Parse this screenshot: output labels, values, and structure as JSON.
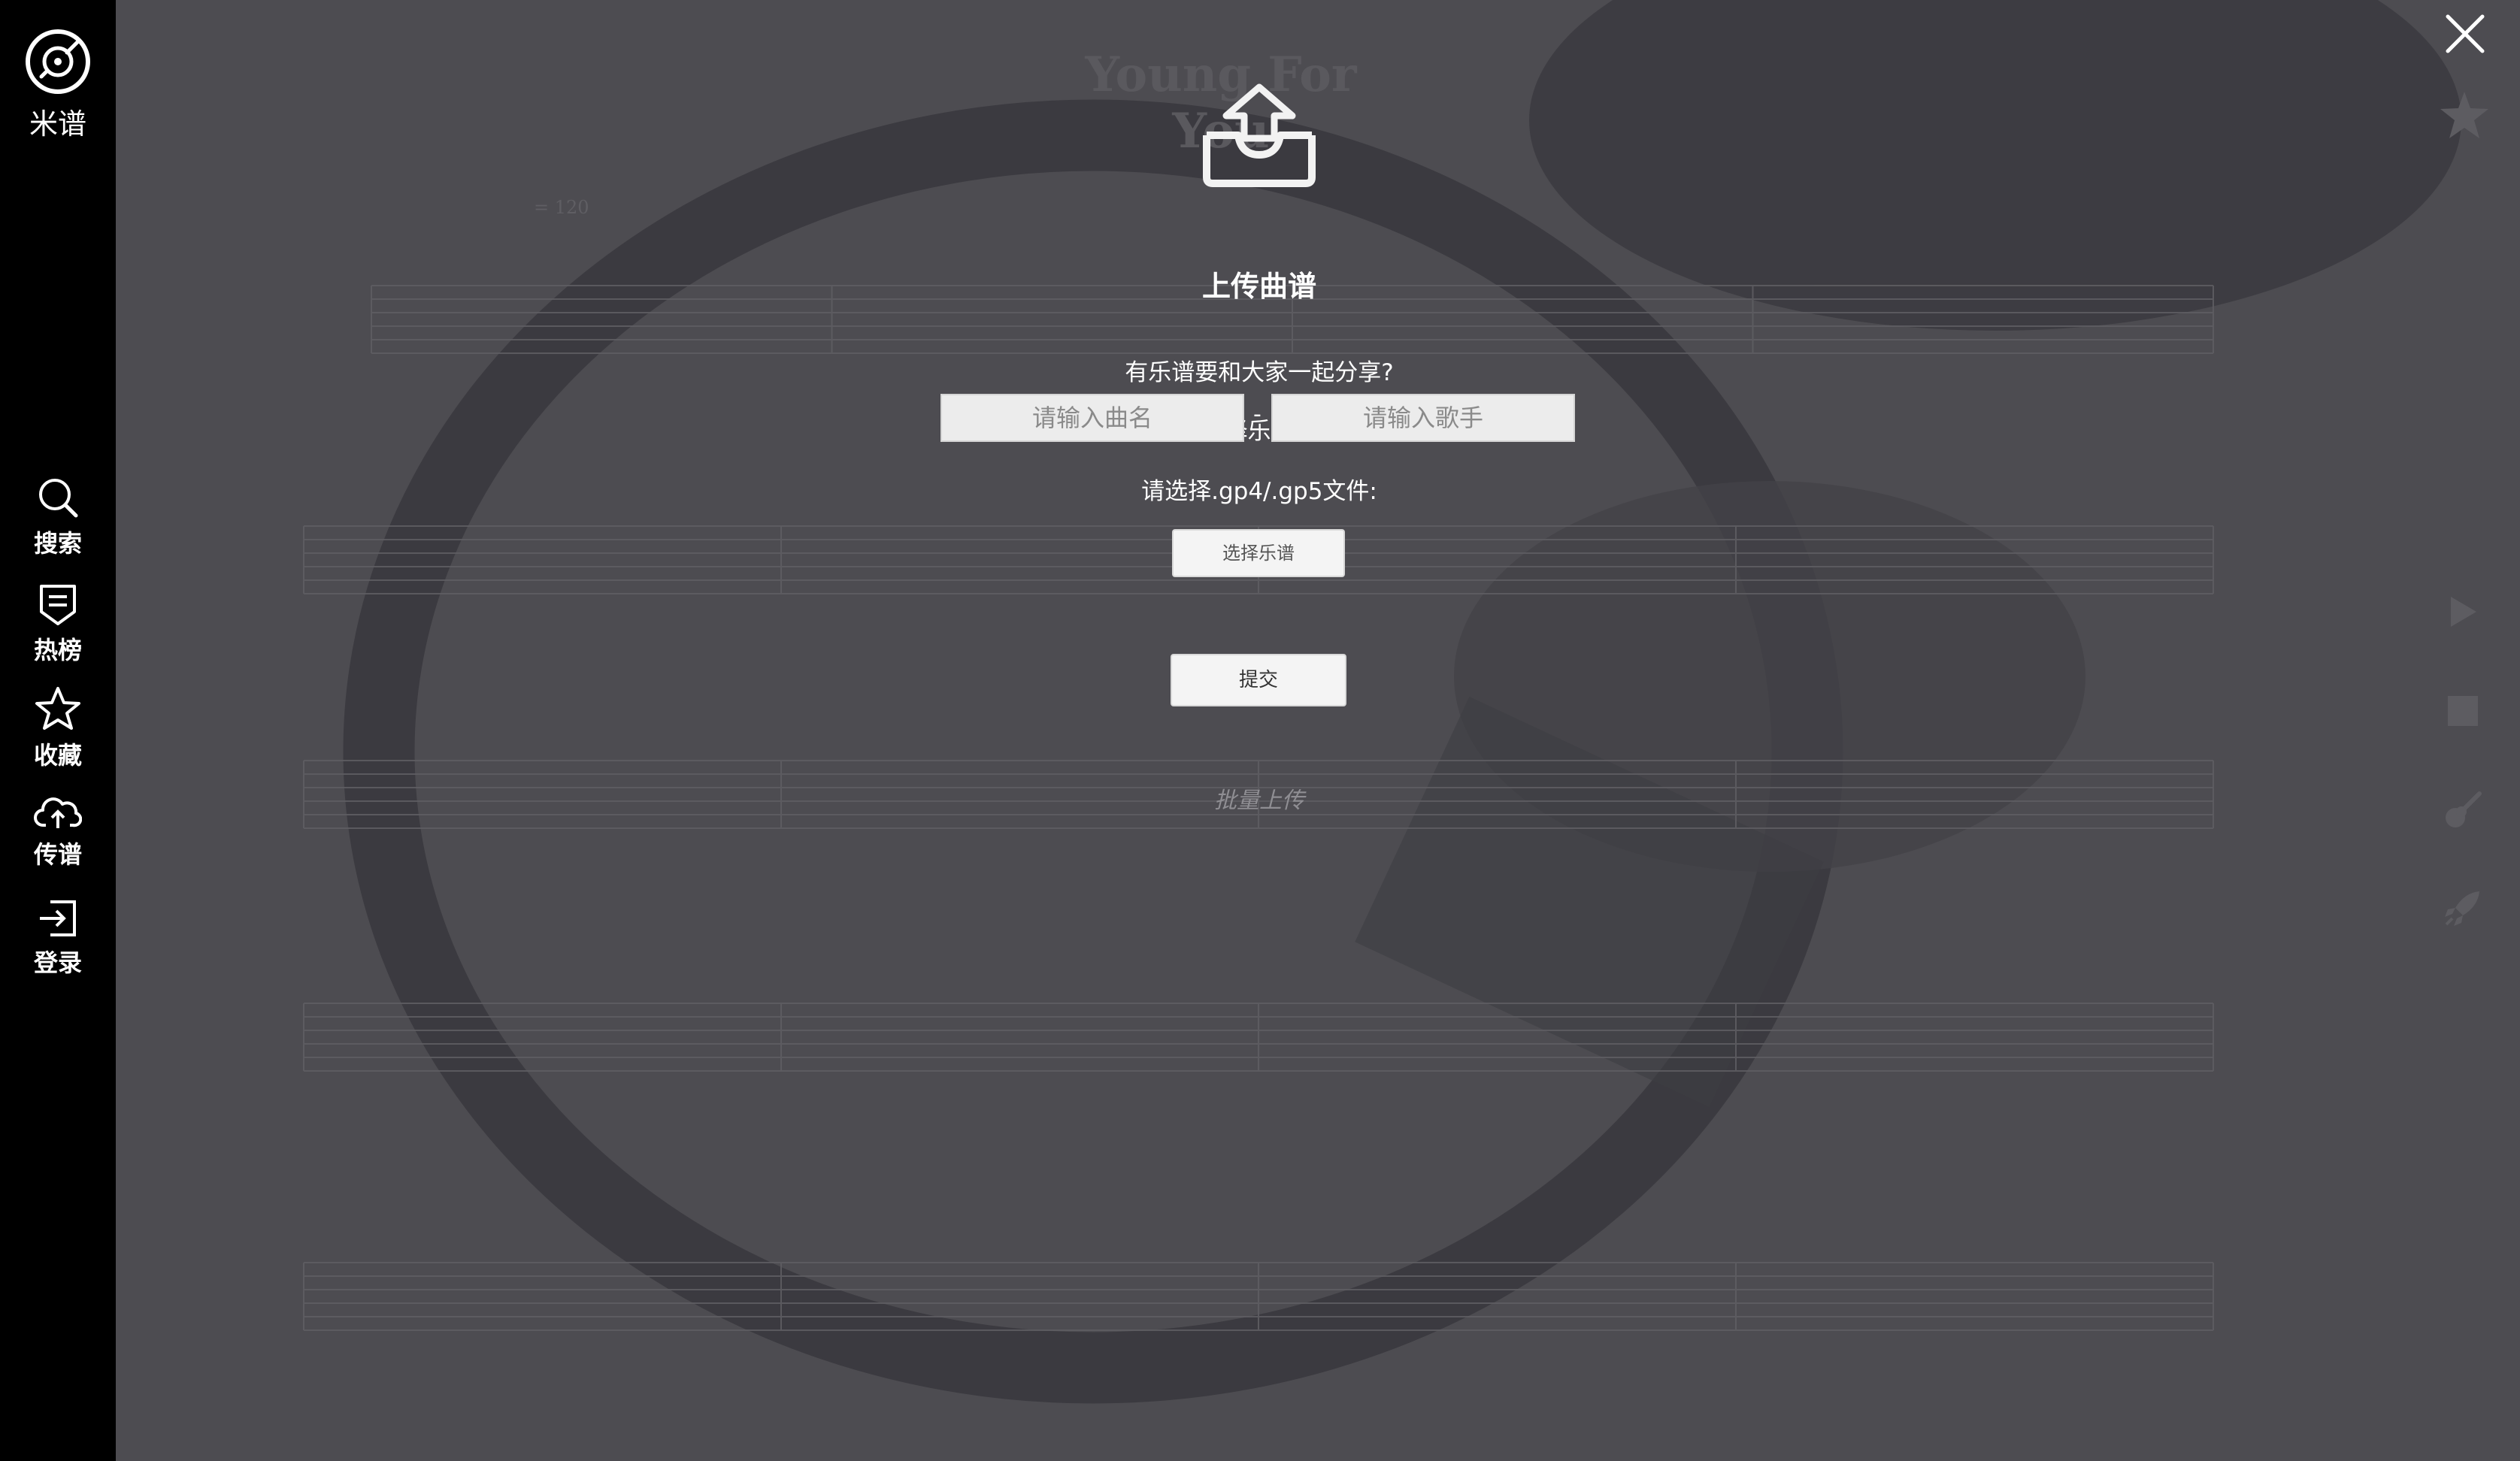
{
  "sidebar": {
    "brand_label": "米谱",
    "items": [
      {
        "label": "搜索",
        "icon": "search-icon"
      },
      {
        "label": "热榜",
        "icon": "ranking-icon"
      },
      {
        "label": "收藏",
        "icon": "star-icon"
      },
      {
        "label": "传谱",
        "icon": "cloud-upload-icon"
      },
      {
        "label": "登录",
        "icon": "login-icon"
      }
    ]
  },
  "sheet": {
    "title": "Young For You",
    "tempo": "= 120"
  },
  "dialog": {
    "title": "上传曲谱",
    "line1": "有乐谱要和大家一起分享?",
    "line2": "填写信息同时选择乐谱文件并点击提交",
    "song_placeholder": "请输入曲名",
    "separator": "-",
    "artist_placeholder": "请输入歌手",
    "file_prompt": "请选择.gp4/.gp5文件:",
    "choose_file_label": "选择乐谱",
    "submit_label": "提交",
    "batch_label": "批量上传"
  },
  "colors": {
    "sidebar_bg": "#000000",
    "overlay_bg": "#4d4c51",
    "text": "#ffffff"
  }
}
